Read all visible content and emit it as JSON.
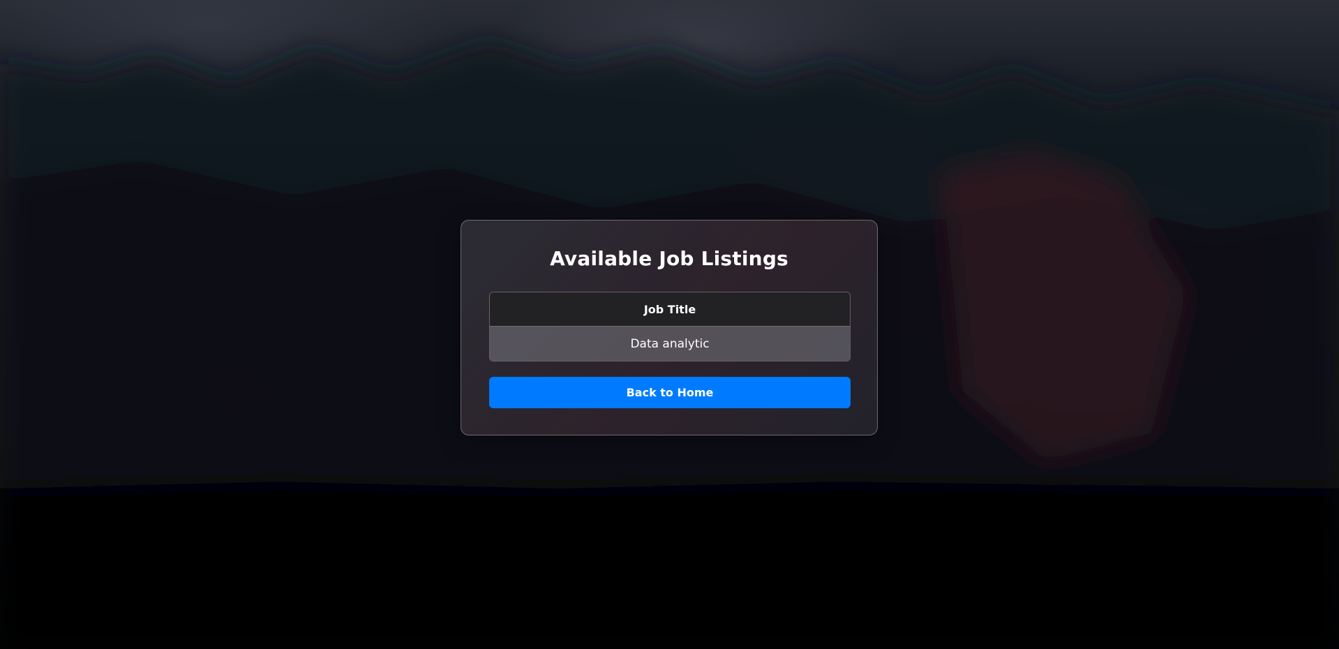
{
  "card": {
    "title": "Available Job Listings"
  },
  "table": {
    "header": "Job Title",
    "rows": [
      "Data analytic"
    ]
  },
  "back_button": {
    "label": "Back to Home",
    "color": "#007bff"
  }
}
